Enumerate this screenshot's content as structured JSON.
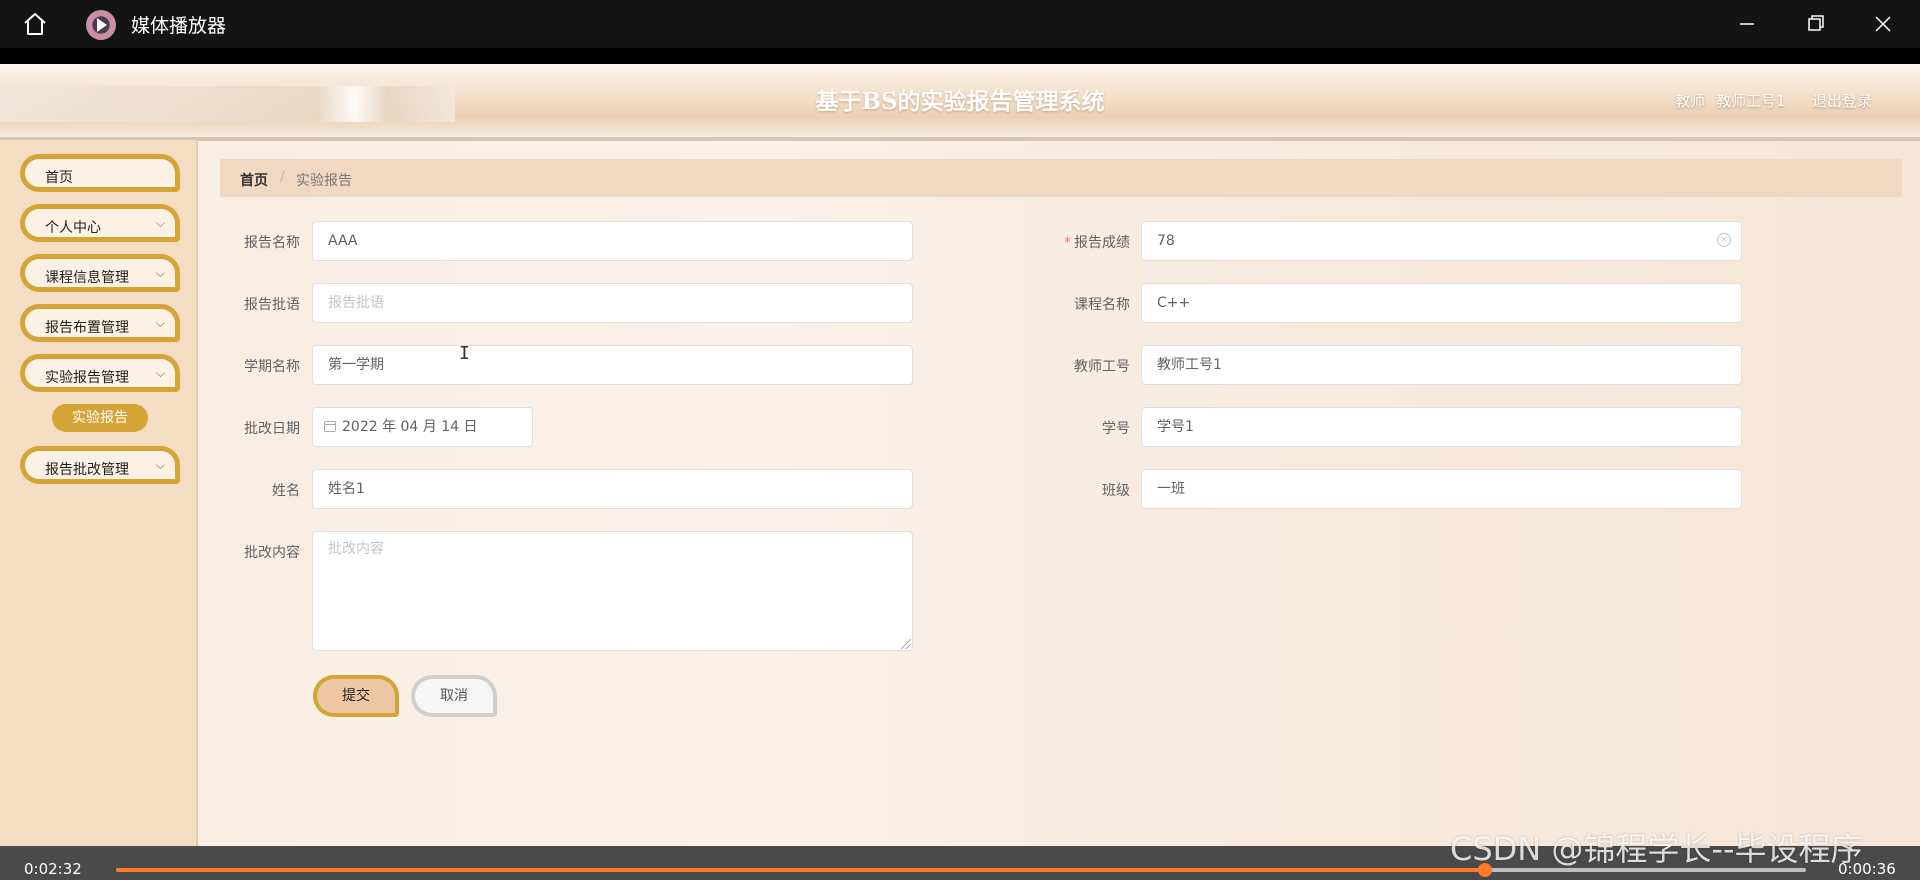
{
  "player": {
    "title": "媒体播放器",
    "current_time": "0:02:32",
    "remaining_time": "0:00:36",
    "progress": 0.81
  },
  "header": {
    "title": "基于BS的实验报告管理系统",
    "role": "教师",
    "user": "教师工号1",
    "logout": "退出登录"
  },
  "sidebar": {
    "items": [
      {
        "label": "首页",
        "chevron": false
      },
      {
        "label": "个人中心",
        "chevron": true
      },
      {
        "label": "课程信息管理",
        "chevron": true
      },
      {
        "label": "报告布置管理",
        "chevron": true
      },
      {
        "label": "实验报告管理",
        "chevron": true
      },
      {
        "label": "报告批改管理",
        "chevron": true
      }
    ],
    "active_sub": "实验报告"
  },
  "breadcrumb": {
    "home": "首页",
    "separator": "/",
    "current": "实验报告"
  },
  "form": {
    "report_name": {
      "label": "报告名称",
      "value": "AAA"
    },
    "report_score": {
      "label": "报告成绩",
      "value": "78",
      "required_mark": "*"
    },
    "report_comment": {
      "label": "报告批语",
      "placeholder": "报告批语"
    },
    "course_name": {
      "label": "课程名称",
      "value": "C++"
    },
    "semester": {
      "label": "学期名称",
      "value": "第一学期"
    },
    "teacher_id": {
      "label": "教师工号",
      "value": "教师工号1"
    },
    "review_date": {
      "label": "批改日期",
      "value": "2022 年 04 月 14 日"
    },
    "student_id": {
      "label": "学号",
      "value": "学号1"
    },
    "name": {
      "label": "姓名",
      "value": "姓名1"
    },
    "class": {
      "label": "班级",
      "value": "一班"
    },
    "review_content": {
      "label": "批改内容",
      "placeholder": "批改内容"
    },
    "submit": "提交",
    "cancel": "取消"
  },
  "watermark": "CSDN @锦程学长--毕设程序",
  "colors": {
    "accent": "#d4a437",
    "progress": "#ff7a2a",
    "required": "#f56c6c"
  }
}
